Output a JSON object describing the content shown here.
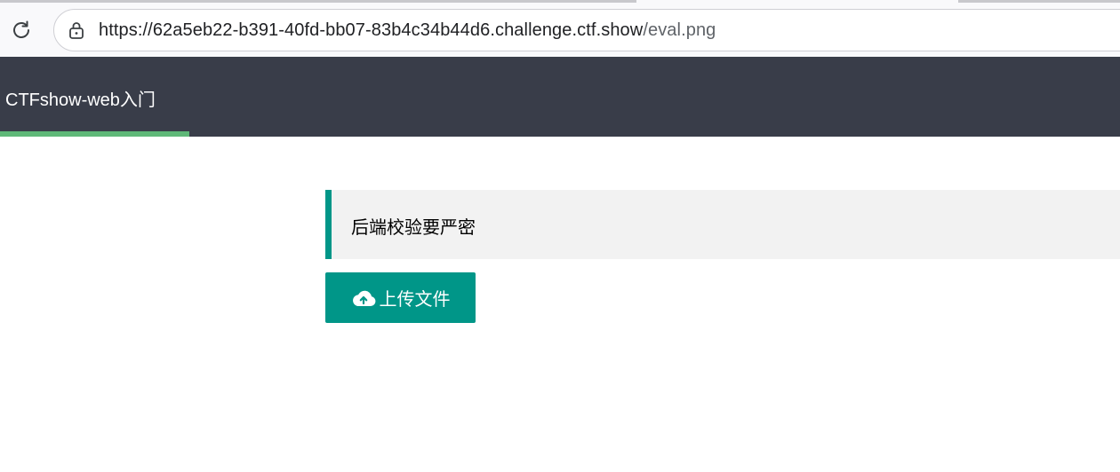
{
  "browser": {
    "url_base": "https://62a5eb22-b391-40fd-bb07-83b4c34b44d6.challenge.ctf.show",
    "url_path": "/eval.png",
    "reload_icon": "reload-icon",
    "lock_icon": "lock-icon"
  },
  "nav": {
    "items": [
      {
        "label": "CTFshow-web入门",
        "active": true
      }
    ],
    "background_color": "#393d49",
    "active_indicator_color": "#5fb878"
  },
  "main": {
    "notice_text": "后端校验要严密",
    "notice_accent_color": "#009688",
    "upload_button": {
      "label": "上传文件",
      "icon": "cloud-upload-icon",
      "color": "#009688"
    }
  }
}
